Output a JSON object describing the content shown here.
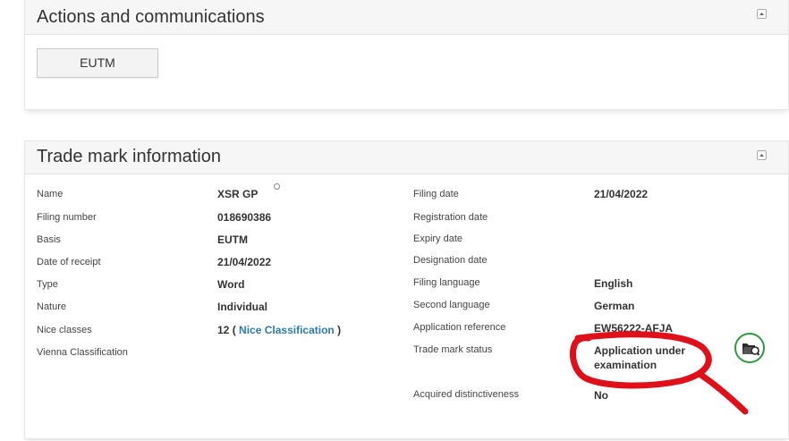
{
  "actions_panel": {
    "title": "Actions and communications",
    "eutm_button": "EUTM"
  },
  "trade_mark_panel": {
    "title": "Trade mark information",
    "left": {
      "name_label": "Name",
      "name_value": "XSR GP",
      "filing_number_label": "Filing number",
      "filing_number_value": "018690386",
      "basis_label": "Basis",
      "basis_value": "EUTM",
      "date_of_receipt_label": "Date of receipt",
      "date_of_receipt_value": "21/04/2022",
      "type_label": "Type",
      "type_value": "Word",
      "nature_label": "Nature",
      "nature_value": "Individual",
      "nice_classes_label": "Nice classes",
      "nice_classes_value": "12",
      "nice_paren_open": "(",
      "nice_link": "Nice Classification",
      "nice_paren_close": ")",
      "vienna_label": "Vienna Classification"
    },
    "right": {
      "filing_date_label": "Filing date",
      "filing_date_value": "21/04/2022",
      "registration_date_label": "Registration date",
      "expiry_date_label": "Expiry date",
      "designation_date_label": "Designation date",
      "filing_language_label": "Filing language",
      "filing_language_value": "English",
      "second_language_label": "Second language",
      "second_language_value": "German",
      "application_reference_label": "Application reference",
      "application_reference_value": "EW56222-AFJA",
      "trade_mark_status_label": "Trade mark status",
      "trade_mark_status_line1": "Application under",
      "trade_mark_status_line2": "examination",
      "acquired_distinctiveness_label": "Acquired distinctiveness",
      "acquired_distinctiveness_value": "No"
    }
  },
  "icons": {
    "collapse": "collapse-icon",
    "documents": "folder-icon"
  },
  "colors": {
    "link": "#2a7ab0",
    "doc_button": "#2e9a3e",
    "annotation": "#e0101a"
  }
}
